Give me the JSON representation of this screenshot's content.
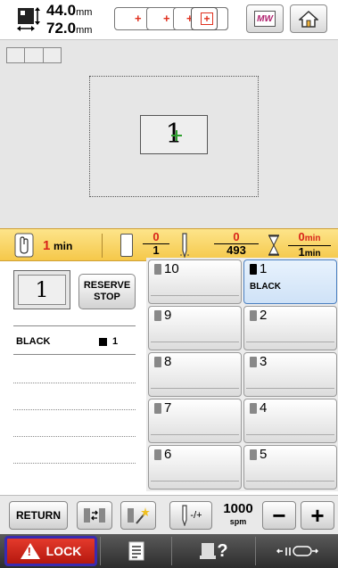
{
  "top_bar": {
    "width_value": "44.0",
    "height_value": "72.0",
    "unit": "mm",
    "hoop_buttons": [
      "+",
      "+",
      "+",
      "+"
    ],
    "mw_button_label": "MW"
  },
  "preview": {
    "design_char": "1"
  },
  "status": {
    "time_value": "1",
    "time_unit": "min",
    "color_current": "0",
    "color_total": "1",
    "stitch_current": "0",
    "stitch_total": "493",
    "remaining_current": "0",
    "remaining_current_unit": "min",
    "remaining_total": "1",
    "remaining_total_unit": "min"
  },
  "left_panel": {
    "thumb_char": "1",
    "reserve_stop_line1": "RESERVE",
    "reserve_stop_line2": "STOP",
    "color_name": "BLACK",
    "color_index": "1"
  },
  "needles": [
    {
      "label": "10",
      "color_name": ""
    },
    {
      "label": "1",
      "color_name": "BLACK"
    },
    {
      "label": "9",
      "color_name": ""
    },
    {
      "label": "2",
      "color_name": ""
    },
    {
      "label": "8",
      "color_name": ""
    },
    {
      "label": "3",
      "color_name": ""
    },
    {
      "label": "7",
      "color_name": ""
    },
    {
      "label": "4",
      "color_name": ""
    },
    {
      "label": "6",
      "color_name": ""
    },
    {
      "label": "5",
      "color_name": ""
    }
  ],
  "toolbar": {
    "return_label": "RETURN",
    "speed_value": "1000",
    "speed_unit": "spm",
    "minus_label": "−",
    "plus_label": "+",
    "tension_label": "-/+"
  },
  "footer": {
    "lock_label": "LOCK",
    "help_label": "?"
  },
  "colors": {
    "accent_red": "#d8241a",
    "status_bar": "#f5c84a",
    "active_needle": "#cfe2f7",
    "lock_red": "#c8190f"
  }
}
